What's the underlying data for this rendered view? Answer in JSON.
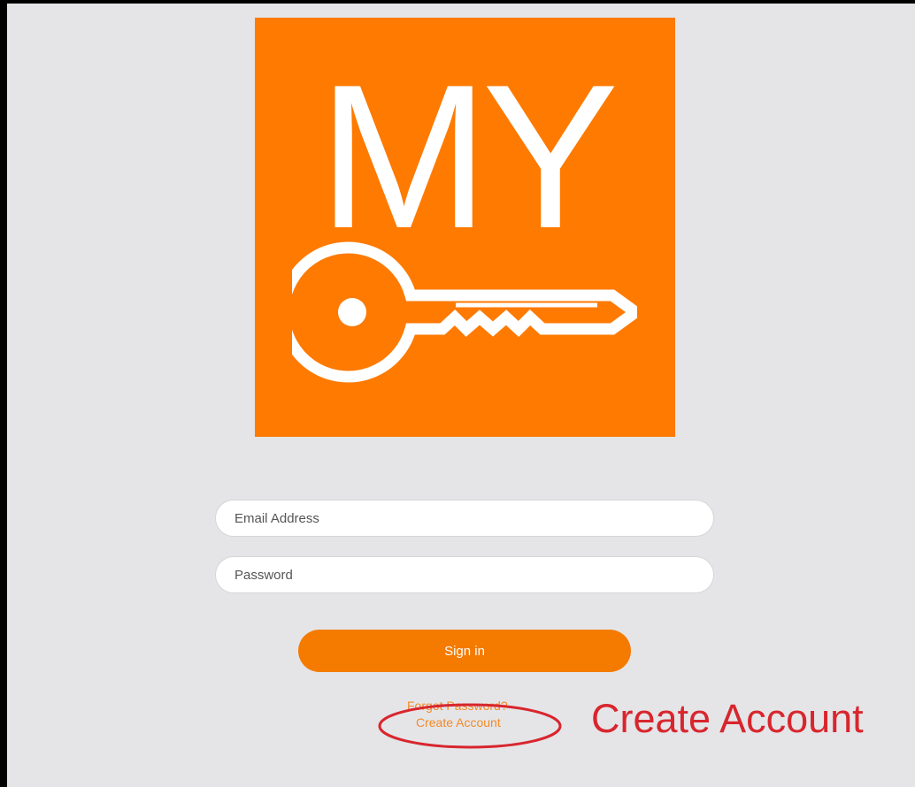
{
  "logo": {
    "text": "MY",
    "icon": "key-icon",
    "background_color": "#fe7a00"
  },
  "form": {
    "email_placeholder": "Email Address",
    "password_placeholder": "Password",
    "signin_label": "Sign in",
    "forgot_password_label": "Forgot Password?",
    "create_account_label": "Create Account"
  },
  "annotation": {
    "text": "Create Account",
    "color": "#d8262e"
  },
  "colors": {
    "background": "#e5e5e8",
    "accent": "#f57a00",
    "link": "#f28b27"
  }
}
